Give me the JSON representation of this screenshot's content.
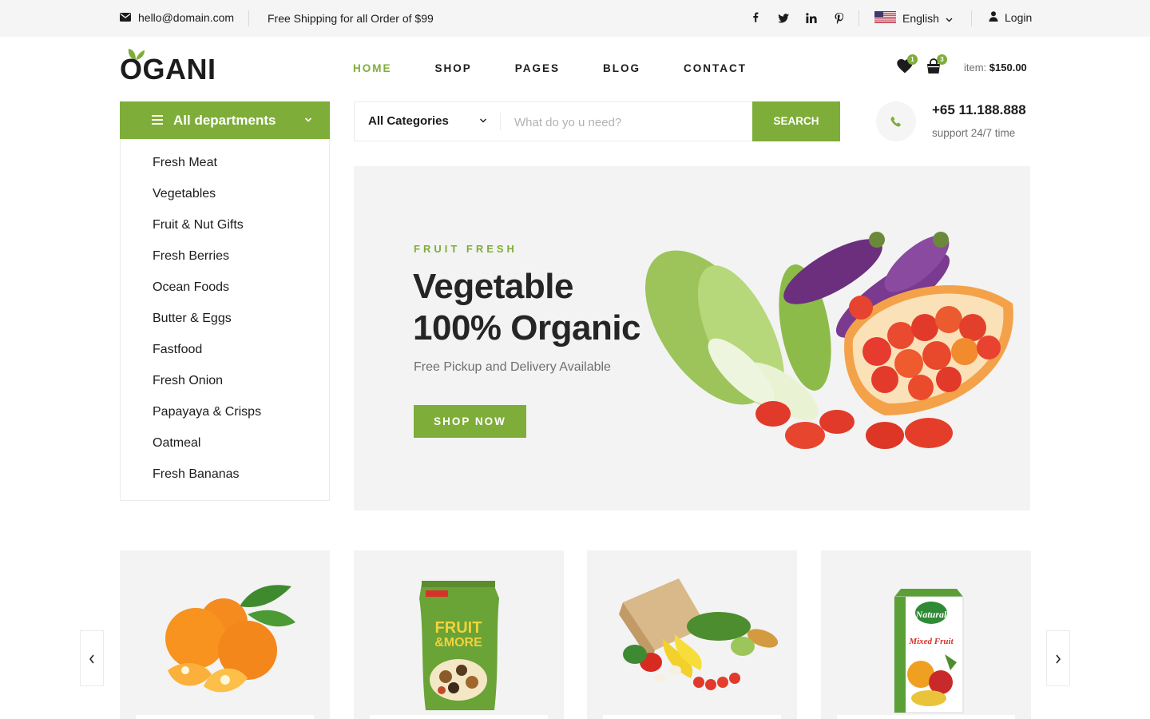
{
  "topbar": {
    "email": "hello@domain.com",
    "shipping": "Free Shipping for all Order of $99",
    "socials": [
      "facebook-icon",
      "twitter-icon",
      "linkedin-icon",
      "pinterest-icon"
    ],
    "language": "English",
    "login": "Login"
  },
  "header": {
    "logo": "OGANI",
    "nav": [
      "HOME",
      "SHOP",
      "PAGES",
      "BLOG",
      "CONTACT"
    ],
    "active_nav": "HOME",
    "wishlist_count": "1",
    "cart_count": "3",
    "total_label": "item:",
    "total_value": "$150.00"
  },
  "departments": {
    "title": "All departments",
    "items": [
      "Fresh Meat",
      "Vegetables",
      "Fruit & Nut Gifts",
      "Fresh Berries",
      "Ocean Foods",
      "Butter & Eggs",
      "Fastfood",
      "Fresh Onion",
      "Papayaya & Crisps",
      "Oatmeal",
      "Fresh Bananas"
    ]
  },
  "search": {
    "category": "All Categories",
    "placeholder": "What do yo u need?",
    "button": "SEARCH"
  },
  "contact": {
    "phone": "+65 11.188.888",
    "support": "support 24/7 time"
  },
  "hero": {
    "eyebrow": "FRUIT FRESH",
    "title_line1": "Vegetable",
    "title_line2": "100% Organic",
    "subtitle": "Free Pickup and Delivery Available",
    "button": "SHOP NOW"
  },
  "carousel": {
    "items": [
      "oranges-image",
      "dried-fruits-image",
      "grocery-bag-image",
      "juice-carton-image"
    ]
  },
  "colors": {
    "accent": "#7fad39",
    "topbar_bg": "#f5f5f5",
    "card_bg": "#f3f3f3",
    "text": "#1c1c1c"
  }
}
